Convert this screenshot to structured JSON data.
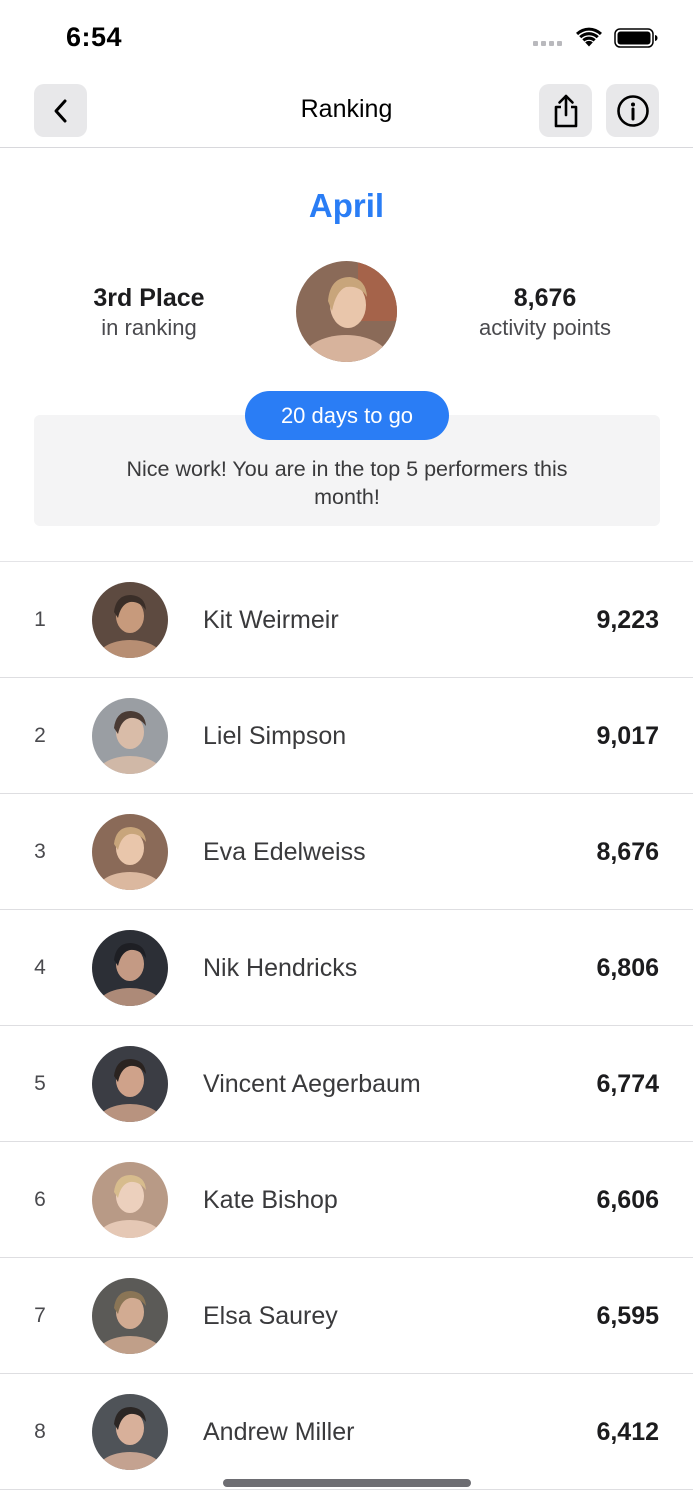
{
  "status_bar": {
    "time": "6:54",
    "icons": [
      "cellular-signal-icon",
      "wifi-icon",
      "battery-icon"
    ]
  },
  "nav": {
    "title": "Ranking",
    "back_icon": "chevron-left-icon",
    "share_icon": "share-icon",
    "info_icon": "info-icon"
  },
  "summary": {
    "month": "April",
    "place": "3rd Place",
    "place_caption": "in ranking",
    "points": "8,676",
    "points_caption": "activity points",
    "days_to_go": "20 days to go",
    "message": "Nice work! You are in the top 5 performers this month!"
  },
  "ranking": [
    {
      "rank": "1",
      "name": "Kit Weirmeir",
      "points": "9,223"
    },
    {
      "rank": "2",
      "name": "Liel Simpson",
      "points": "9,017"
    },
    {
      "rank": "3",
      "name": "Eva Edelweiss",
      "points": "8,676"
    },
    {
      "rank": "4",
      "name": "Nik Hendricks",
      "points": "6,806"
    },
    {
      "rank": "5",
      "name": "Vincent Aegerbaum",
      "points": "6,774"
    },
    {
      "rank": "6",
      "name": "Kate Bishop",
      "points": "6,606"
    },
    {
      "rank": "7",
      "name": "Elsa Saurey",
      "points": "6,595"
    },
    {
      "rank": "8",
      "name": "Andrew Miller",
      "points": "6,412"
    }
  ],
  "colors": {
    "accent": "#2a7df5",
    "nav_button_bg": "#e8e8ea",
    "message_bg": "#f4f4f5"
  }
}
